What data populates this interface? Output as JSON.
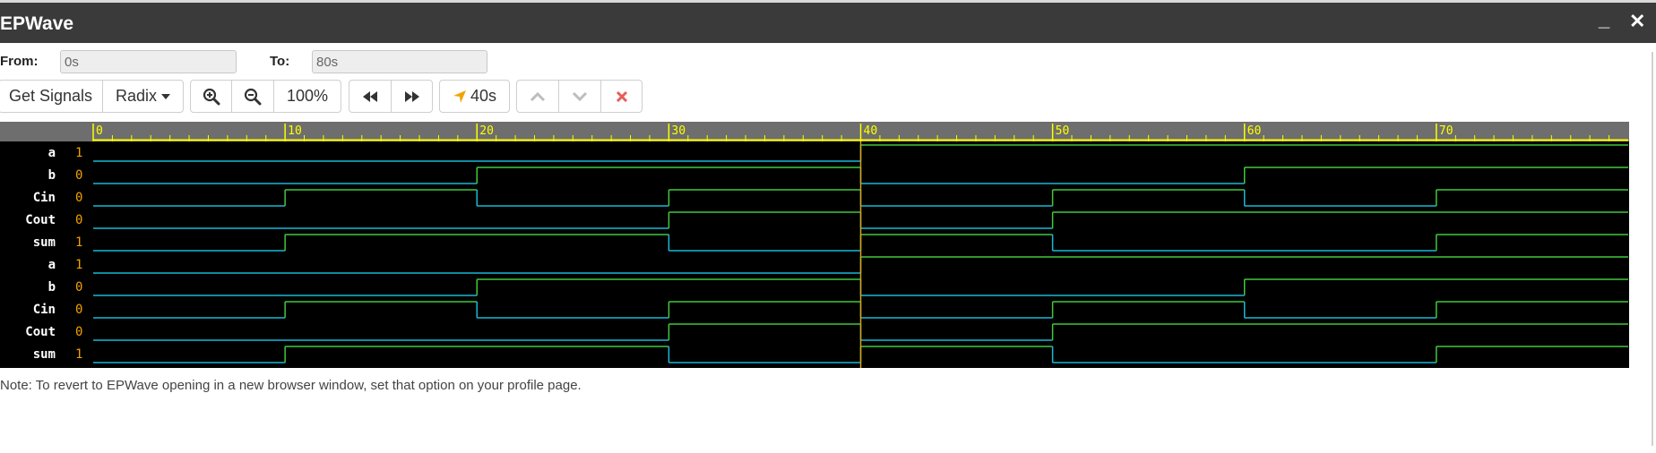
{
  "window": {
    "title": "EPWave",
    "minimize_label": "_",
    "close_label": "✕"
  },
  "range": {
    "from_label": "From:",
    "from_value": "0s",
    "to_label": "To:",
    "to_value": "80s"
  },
  "toolbar": {
    "get_signals_label": "Get Signals",
    "radix_label": "Radix",
    "zoom_in_icon": "zoom-in-icon",
    "zoom_out_icon": "zoom-out-icon",
    "zoom_level": "100%",
    "jump_back_icon": "fast-backward-icon",
    "jump_forward_icon": "fast-forward-icon",
    "cursor_time": "40s",
    "cursor_icon": "location-arrow-icon",
    "move_up_icon": "chevron-up-icon",
    "move_down_icon": "chevron-down-icon",
    "remove_icon": "delete-x-icon"
  },
  "colors": {
    "axis_bg": "#6e6e6e",
    "tick": "#ffff00",
    "wave_low": "#17b8d6",
    "wave_high": "#41c83a",
    "cursor": "#d6a21a",
    "value_text": "#f5a000",
    "name_text": "#ffffff",
    "remove": "#e85c5c"
  },
  "timeline": {
    "start": 0,
    "end": 80,
    "major_ticks": [
      0,
      10,
      20,
      30,
      40,
      50,
      60,
      70
    ],
    "cursor_time": 40
  },
  "signals": [
    {
      "name": "a",
      "value": "1",
      "transitions": [
        [
          0,
          0
        ],
        [
          40,
          1
        ]
      ]
    },
    {
      "name": "b",
      "value": "0",
      "transitions": [
        [
          0,
          0
        ],
        [
          20,
          1
        ],
        [
          40,
          0
        ],
        [
          60,
          1
        ]
      ]
    },
    {
      "name": "Cin",
      "value": "0",
      "transitions": [
        [
          0,
          0
        ],
        [
          10,
          1
        ],
        [
          20,
          0
        ],
        [
          30,
          1
        ],
        [
          40,
          0
        ],
        [
          50,
          1
        ],
        [
          60,
          0
        ],
        [
          70,
          1
        ]
      ]
    },
    {
      "name": "Cout",
      "value": "0",
      "transitions": [
        [
          0,
          0
        ],
        [
          30,
          1
        ],
        [
          40,
          0
        ],
        [
          50,
          1
        ]
      ]
    },
    {
      "name": "sum",
      "value": "1",
      "transitions": [
        [
          0,
          0
        ],
        [
          10,
          1
        ],
        [
          30,
          0
        ],
        [
          40,
          1
        ],
        [
          50,
          0
        ],
        [
          70,
          1
        ]
      ]
    },
    {
      "name": "a",
      "value": "1",
      "transitions": [
        [
          0,
          0
        ],
        [
          40,
          1
        ]
      ]
    },
    {
      "name": "b",
      "value": "0",
      "transitions": [
        [
          0,
          0
        ],
        [
          20,
          1
        ],
        [
          40,
          0
        ],
        [
          60,
          1
        ]
      ]
    },
    {
      "name": "Cin",
      "value": "0",
      "transitions": [
        [
          0,
          0
        ],
        [
          10,
          1
        ],
        [
          20,
          0
        ],
        [
          30,
          1
        ],
        [
          40,
          0
        ],
        [
          50,
          1
        ],
        [
          60,
          0
        ],
        [
          70,
          1
        ]
      ]
    },
    {
      "name": "Cout",
      "value": "0",
      "transitions": [
        [
          0,
          0
        ],
        [
          30,
          1
        ],
        [
          40,
          0
        ],
        [
          50,
          1
        ]
      ]
    },
    {
      "name": "sum",
      "value": "1",
      "transitions": [
        [
          0,
          0
        ],
        [
          10,
          1
        ],
        [
          30,
          0
        ],
        [
          40,
          1
        ],
        [
          50,
          0
        ],
        [
          70,
          1
        ]
      ]
    }
  ],
  "note": "Note: To revert to EPWave opening in a new browser window, set that option on your profile page."
}
